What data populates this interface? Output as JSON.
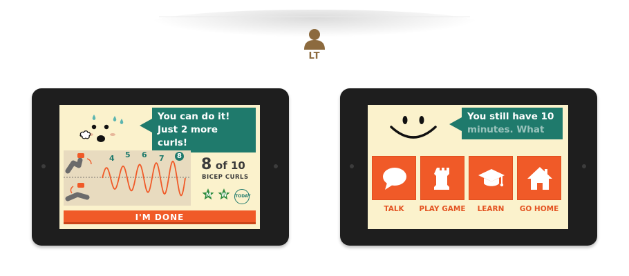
{
  "user": {
    "initials": "LT",
    "icon": "user-icon"
  },
  "colors": {
    "accent_orange": "#f05a28",
    "teal": "#1f7a6c",
    "screen_bg": "#fbf2cc",
    "avatar_brown": "#8c6a3e"
  },
  "left_tablet": {
    "speech": {
      "line1": "You can do it!",
      "line2": "Just 2 more curls!"
    },
    "rep_numbers": [
      "4",
      "5",
      "6",
      "7",
      "8"
    ],
    "counter": {
      "current": "8",
      "of_text": "of 10",
      "exercise": "BICEP CURLS"
    },
    "day_badges": [
      "M",
      "W"
    ],
    "today_badge": "TODAY",
    "done_button": "I'M DONE"
  },
  "right_tablet": {
    "speech": {
      "line1": "You still have 10",
      "line2": "minutes. What"
    },
    "menu": [
      {
        "label": "TALK",
        "icon": "speech-bubble-icon"
      },
      {
        "label": "PLAY GAME",
        "icon": "chess-rook-icon"
      },
      {
        "label": "LEARN",
        "icon": "graduation-cap-icon"
      },
      {
        "label": "GO HOME",
        "icon": "house-icon"
      }
    ]
  }
}
